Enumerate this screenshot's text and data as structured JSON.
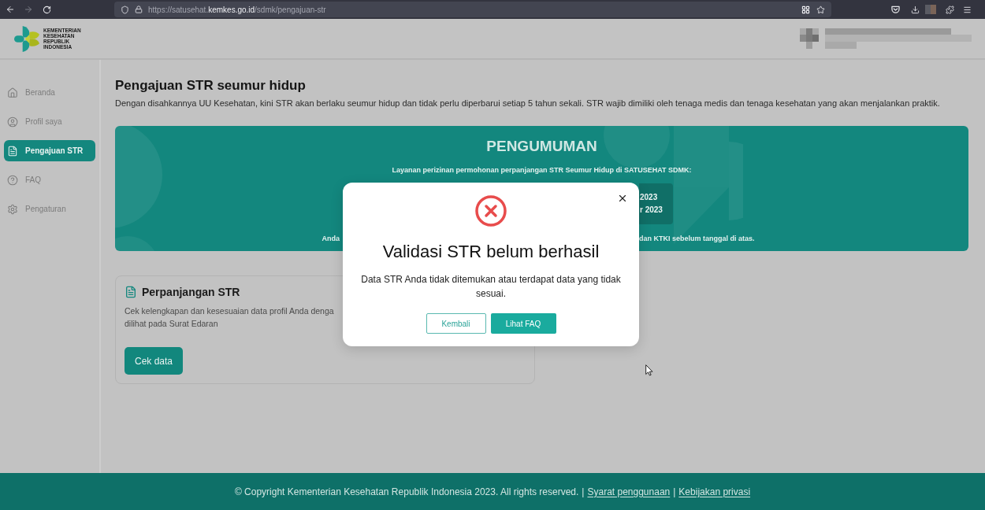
{
  "browser": {
    "url": [
      {
        "text": "https://satusehat.",
        "emphasis": false
      },
      {
        "text": "kemkes.go.id",
        "emphasis": true
      },
      {
        "text": "/sdmk/pengajuan-str",
        "emphasis": false
      }
    ]
  },
  "header": {
    "logo_text": [
      "KEMENTERIAN",
      "KESEHATAN",
      "REPUBLIK",
      "INDONESIA"
    ]
  },
  "sidebar": {
    "items": [
      {
        "label": "Beranda",
        "selected": false
      },
      {
        "label": "Profil saya",
        "selected": false
      },
      {
        "label": "Pengajuan STR",
        "selected": true
      },
      {
        "label": "FAQ",
        "selected": false
      },
      {
        "label": "Pengaturan",
        "selected": false
      }
    ]
  },
  "page": {
    "title": "Pengajuan STR seumur hidup",
    "description": "Dengan disahkannya UU Kesehatan, kini STR akan berlaku seumur hidup dan tidak perlu diperbarui setiap 5 tahun sekali. STR wajib dimiliki oleh tenaga medis dan tenaga kesehatan yang akan menjalankan praktik."
  },
  "announcement": {
    "title": "PENGUMUMAN",
    "subtitle": "Layanan perizinan permohonan perpanjangan STR Seumur Hidup di SATUSEHAT SDMK:",
    "date_lines": [
      "2023",
      "r 2023"
    ],
    "note_left": "Anda",
    "note_right": "dan KTKI sebelum tanggal di atas."
  },
  "card": {
    "title": "Perpanjangan STR",
    "description_lines": [
      "Cek kelengkapan dan kesesuaian data profil Anda denga",
      "dilihat pada Surat Edaran"
    ],
    "button": "Cek data"
  },
  "dialog": {
    "title": "Validasi STR belum berhasil",
    "message": "Data STR Anda tidak ditemukan atau terdapat data yang tidak sesuai.",
    "buttons": [
      {
        "label": "Kembali",
        "kind": "outline"
      },
      {
        "label": "Lihat FAQ",
        "kind": "primary"
      }
    ]
  },
  "footer": {
    "items": [
      {
        "kind": "text",
        "text": "© Copyright Kementerian Kesehatan Republik Indonesia 2023. All rights reserved."
      },
      {
        "kind": "separator",
        "text": "|"
      },
      {
        "kind": "link",
        "text": "Syarat penggunaan"
      },
      {
        "kind": "separator",
        "text": "|"
      },
      {
        "kind": "link",
        "text": "Kebijakan privasi"
      }
    ]
  }
}
